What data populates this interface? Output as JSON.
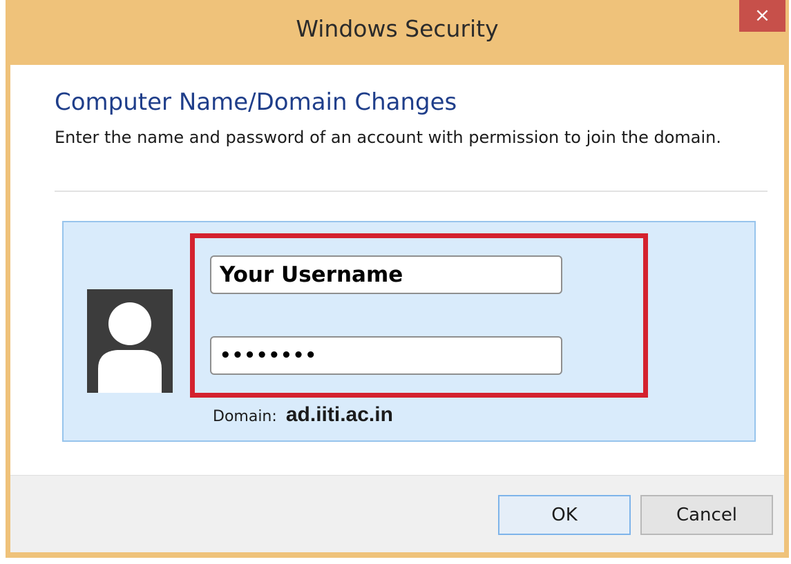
{
  "window": {
    "title": "Windows Security",
    "close_label": "×",
    "frame_color": "#efc27a"
  },
  "content": {
    "heading": "Computer Name/Domain Changes",
    "instruction": "Enter the name and password of an account with permission to join the domain."
  },
  "credentials": {
    "avatar_icon": "user-silhouette-icon",
    "username_value": "Your Username",
    "password_value": "••••••••",
    "domain_label": "Domain:",
    "domain_value": "ad.iiti.ac.in",
    "highlight_color": "#d4222e",
    "panel_color": "#d9ebfb"
  },
  "footer": {
    "ok_label": "OK",
    "cancel_label": "Cancel"
  }
}
